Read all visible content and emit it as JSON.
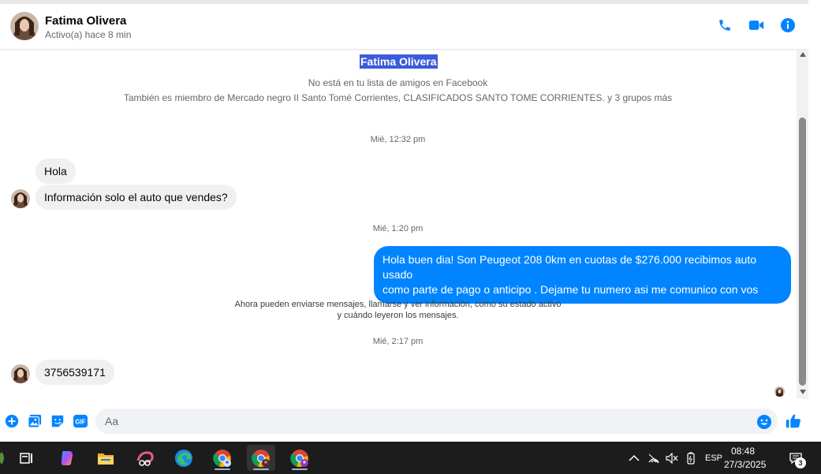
{
  "header": {
    "name": "Fatima Olivera",
    "status": "Activo(a) hace 8 min",
    "icons": [
      "phone-icon",
      "video-camera-icon",
      "info-icon"
    ]
  },
  "intro": {
    "name": "Fatima Olivera",
    "line1": "No está en tu lista de amigos en Facebook",
    "line2": "También es miembro de Mercado negro II Santo Tomé Corrientes, CLASIFICADOS SANTO TOME CORRIENTES. y 3 grupos más"
  },
  "messages": {
    "ts1": "Mié, 12:32 pm",
    "in1": "Hola",
    "in2": "Información solo el auto que vendes?",
    "ts2": "Mié, 1:20 pm",
    "out1_line1": "Hola buen dia! Son Peugeot 208 0km en cuotas de $276.000 recibimos auto usado",
    "out1_line2": "como parte de pago o anticipo . Dejame tu numero asi me comunico con vos",
    "notice_line1": "Ahora pueden enviarse mensajes, llamarse y ver información, como su estado activo",
    "notice_line2": "y cuándo leyeron los mensajes.",
    "ts3": "Mié, 2:17 pm",
    "in3": "3756539171"
  },
  "composer": {
    "placeholder": "Aa",
    "icons": [
      "plus-circle-icon",
      "photo-icon",
      "sticker-icon",
      "gif-icon",
      "emoji-icon",
      "thumbs-up-icon"
    ],
    "gif_label": "GIF"
  },
  "colors": {
    "accent": "#0084ff",
    "incoming_bubble": "#f0f0f0",
    "highlight": "#3b5bdb",
    "taskbar": "#1c1c1c"
  },
  "taskbar": {
    "apps": [
      "widgets-icon",
      "task-view-icon",
      "copilot-icon",
      "file-explorer-icon",
      "snipping-tool-icon",
      "edge-icon",
      "chrome-profile-1-icon",
      "chrome-profile-2-icon",
      "chrome-profile-3-icon"
    ],
    "tray": {
      "language": "ESP",
      "time": "08:48",
      "date": "27/3/2025",
      "notifications": "3"
    }
  }
}
